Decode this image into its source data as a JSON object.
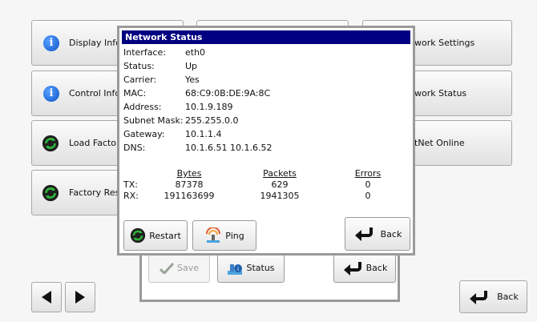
{
  "menu": {
    "display_info": "Display Infor",
    "control_info": "Control Infor",
    "load_factory": "Load Factor",
    "factory_reset": "Factory Res",
    "network_settings": "work Settings",
    "network_status": "work Status",
    "netnet_online": "tNet Online"
  },
  "outer_dialog": {
    "save_label": "Save",
    "status_label": "Status",
    "back_label": "Back"
  },
  "page": {
    "back_label": "Back"
  },
  "network_status": {
    "title": "Network Status",
    "fields": [
      {
        "label": "Interface:",
        "value": "eth0"
      },
      {
        "label": "Status:",
        "value": "Up"
      },
      {
        "label": "Carrier:",
        "value": "Yes"
      },
      {
        "label": "MAC:",
        "value": "68:C9:0B:DE:9A:8C"
      },
      {
        "label": "Address:",
        "value": "10.1.9.189"
      },
      {
        "label": "Subnet Mask:",
        "value": "255.255.0.0"
      },
      {
        "label": "Gateway:",
        "value": "10.1.1.4"
      },
      {
        "label": "DNS:",
        "value": "10.1.6.51  10.1.6.52"
      }
    ],
    "stats": {
      "headers": {
        "bytes": "Bytes",
        "packets": "Packets",
        "errors": "Errors"
      },
      "tx": {
        "label": "TX:",
        "bytes": "87378",
        "packets": "629",
        "errors": "0"
      },
      "rx": {
        "label": "RX:",
        "bytes": "191163699",
        "packets": "1941305",
        "errors": "0"
      }
    },
    "restart_label": "Restart",
    "ping_label": "Ping",
    "back_label": "Back"
  }
}
